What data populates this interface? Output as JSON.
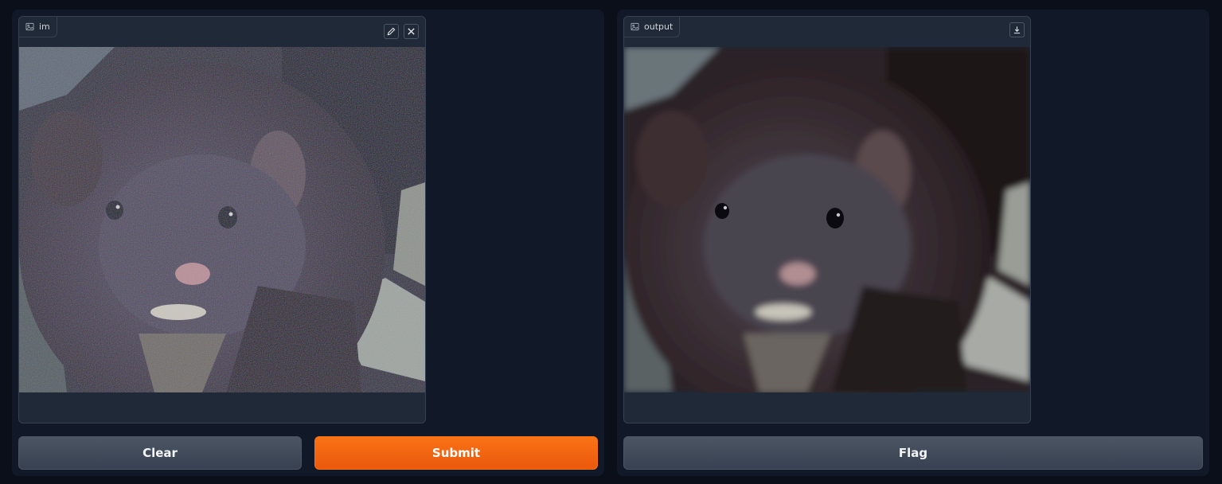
{
  "input_panel": {
    "label": "im",
    "label_icon": "image-icon",
    "edit_icon": "pencil-icon",
    "clear_icon": "close-icon",
    "image_alt": "mink"
  },
  "output_panel": {
    "label": "output",
    "label_icon": "image-icon",
    "download_icon": "download-icon"
  },
  "buttons": {
    "clear_label": "Clear",
    "submit_label": "Submit",
    "flag_label": "Flag"
  },
  "colors": {
    "background": "#0b0f19",
    "panel": "#111827",
    "primary": "#f97316",
    "secondary": "#4b5563"
  }
}
